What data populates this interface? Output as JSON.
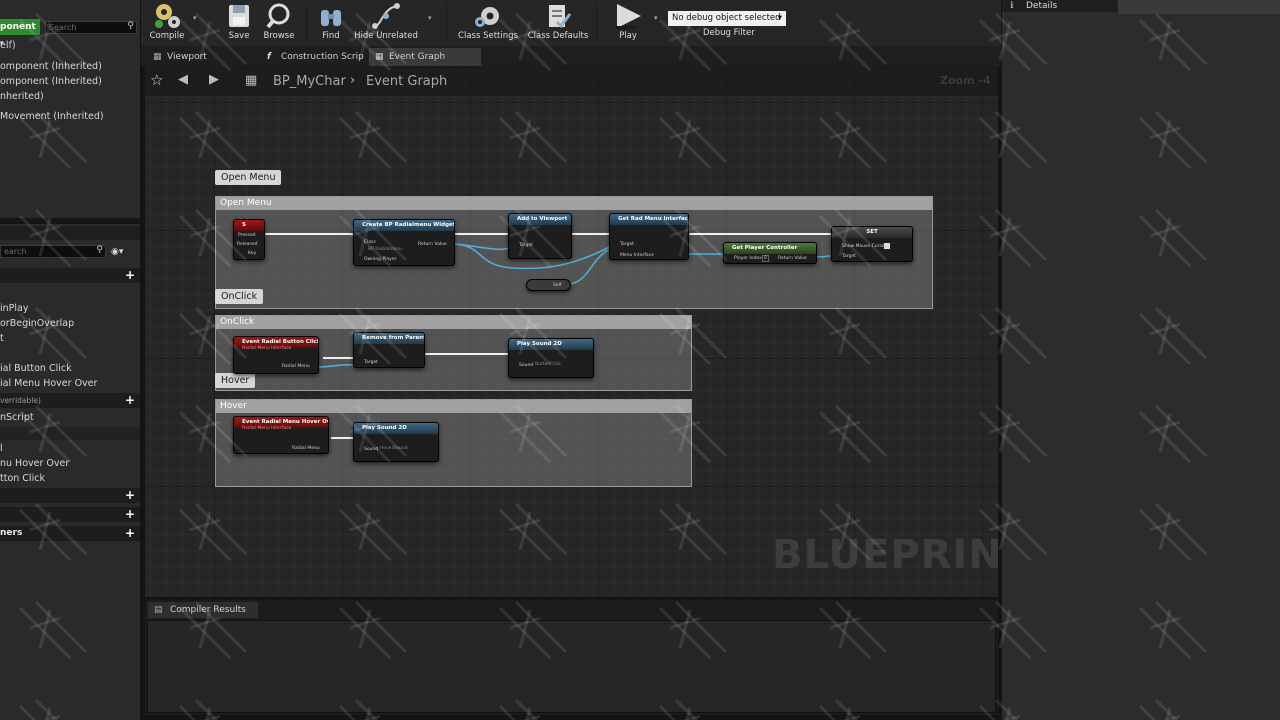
{
  "left_panel": {
    "component_button": "ponent",
    "search_placeholder": "Search",
    "components": [
      "elf)",
      "omponent (Inherited)",
      "omponent (Inherited)",
      "nherited)",
      "Movement (Inherited)"
    ],
    "search2_placeholder": "earch",
    "events": [
      "inPlay",
      "orBeginOverlap",
      "t",
      "ial Button Click",
      "ial Menu Hover Over"
    ],
    "overridable": "verridable)",
    "construction": "nScript",
    "dispatchers": [
      "l",
      "nu Hover Over",
      "tton Click"
    ],
    "bottom_label": "ners"
  },
  "toolbar": {
    "compile": "Compile",
    "browse": "Browse",
    "find": "Find",
    "hide_unrelated": "Hide Unrelated",
    "class_settings": "Class Settings",
    "class_defaults": "Class Defaults",
    "play": "Play",
    "debug_select": "No debug object selected",
    "debug_filter": "Debug Filter",
    "save": "Save"
  },
  "tabs": {
    "viewport": "Viewport",
    "construction": "Construction Scrip",
    "event_graph": "Event Graph"
  },
  "breadcrumb": {
    "blueprint": "BP_MyChar",
    "graph": "Event Graph",
    "zoom": "Zoom -4"
  },
  "graph": {
    "watermark": "BLUEPRINT",
    "comments": {
      "open_menu_bubble": "Open Menu",
      "open_menu_title": "Open Menu",
      "onclick_bubble": "OnClick",
      "onclick_title": "OnClick",
      "hover_bubble": "Hover",
      "hover_title": "Hover"
    },
    "nodes": {
      "key_s": "S",
      "key_pressed": "Pressed",
      "key_released": "Released",
      "key_key": "Key",
      "create_widget": "Create BP Radialmenu Widget",
      "create_class": "Class",
      "create_class_val": "BP Radialmenu",
      "create_return": "Return Value",
      "create_owning": "Owning Player",
      "add_viewport": "Add to Viewport",
      "add_target": "Target",
      "get_radial": "Get Rad Menu Interface",
      "get_target": "Target",
      "get_menu": "Menu Interface",
      "get_pc": "Get Player Controller",
      "pc_index": "Player Index",
      "pc_index_val": "0",
      "pc_return": "Return Value",
      "set": "SET",
      "set_show": "Show Mouse Cursor",
      "set_target": "Target",
      "self": "Self",
      "ev_button_click": "Event Radial Button Click",
      "ev_button_sub": "Radial Menu Interface",
      "radial_menu": "Radial Menu",
      "remove_parent": "Remove from Parent",
      "remove_target": "Target",
      "play_sound": "Play Sound 2D",
      "sound": "Sound",
      "sound_val": "ButtonClick",
      "ev_hover": "Event Radial Menu Hover Over",
      "ev_hover_sub": "Radial Menu Interface",
      "radial_menu2": "Radial Menu",
      "play_sound2": "Play Sound 2D",
      "sound2": "Sound",
      "sound2_val": "HoverSound"
    }
  },
  "right_panel": {
    "details": "Details"
  },
  "compiler": {
    "tab": "Compiler Results"
  }
}
